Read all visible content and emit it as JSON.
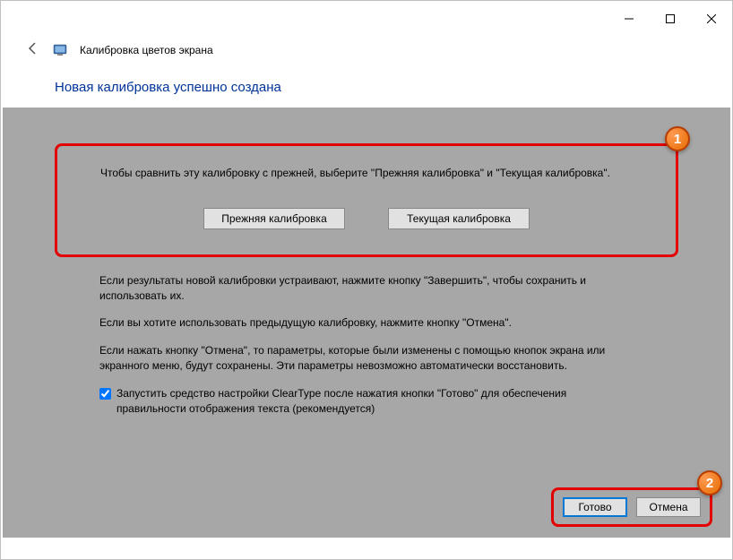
{
  "window": {
    "title": "Калибровка цветов экрана"
  },
  "heading": "Новая калибровка успешно создана",
  "section1": {
    "instruction": "Чтобы сравнить эту калибровку с прежней, выберите \"Прежняя калибровка\" и \"Текущая калибровка\".",
    "prev_button": "Прежняя калибровка",
    "current_button": "Текущая калибровка"
  },
  "body": {
    "p1": "Если результаты новой калибровки устраивают, нажмите кнопку \"Завершить\", чтобы сохранить и использовать их.",
    "p2": "Если вы хотите использовать предыдущую калибровку, нажмите кнопку \"Отмена\".",
    "p3": "Если нажать кнопку \"Отмена\", то параметры, которые были изменены с помощью кнопок экрана или экранного меню, будут сохранены. Эти параметры невозможно автоматически восстановить."
  },
  "checkbox": {
    "label": "Запустить средство настройки ClearType после нажатия кнопки \"Готово\" для обеспечения правильности отображения текста (рекомендуется)"
  },
  "footer": {
    "done": "Готово",
    "cancel": "Отмена"
  },
  "annotations": {
    "badge1": "1",
    "badge2": "2"
  }
}
